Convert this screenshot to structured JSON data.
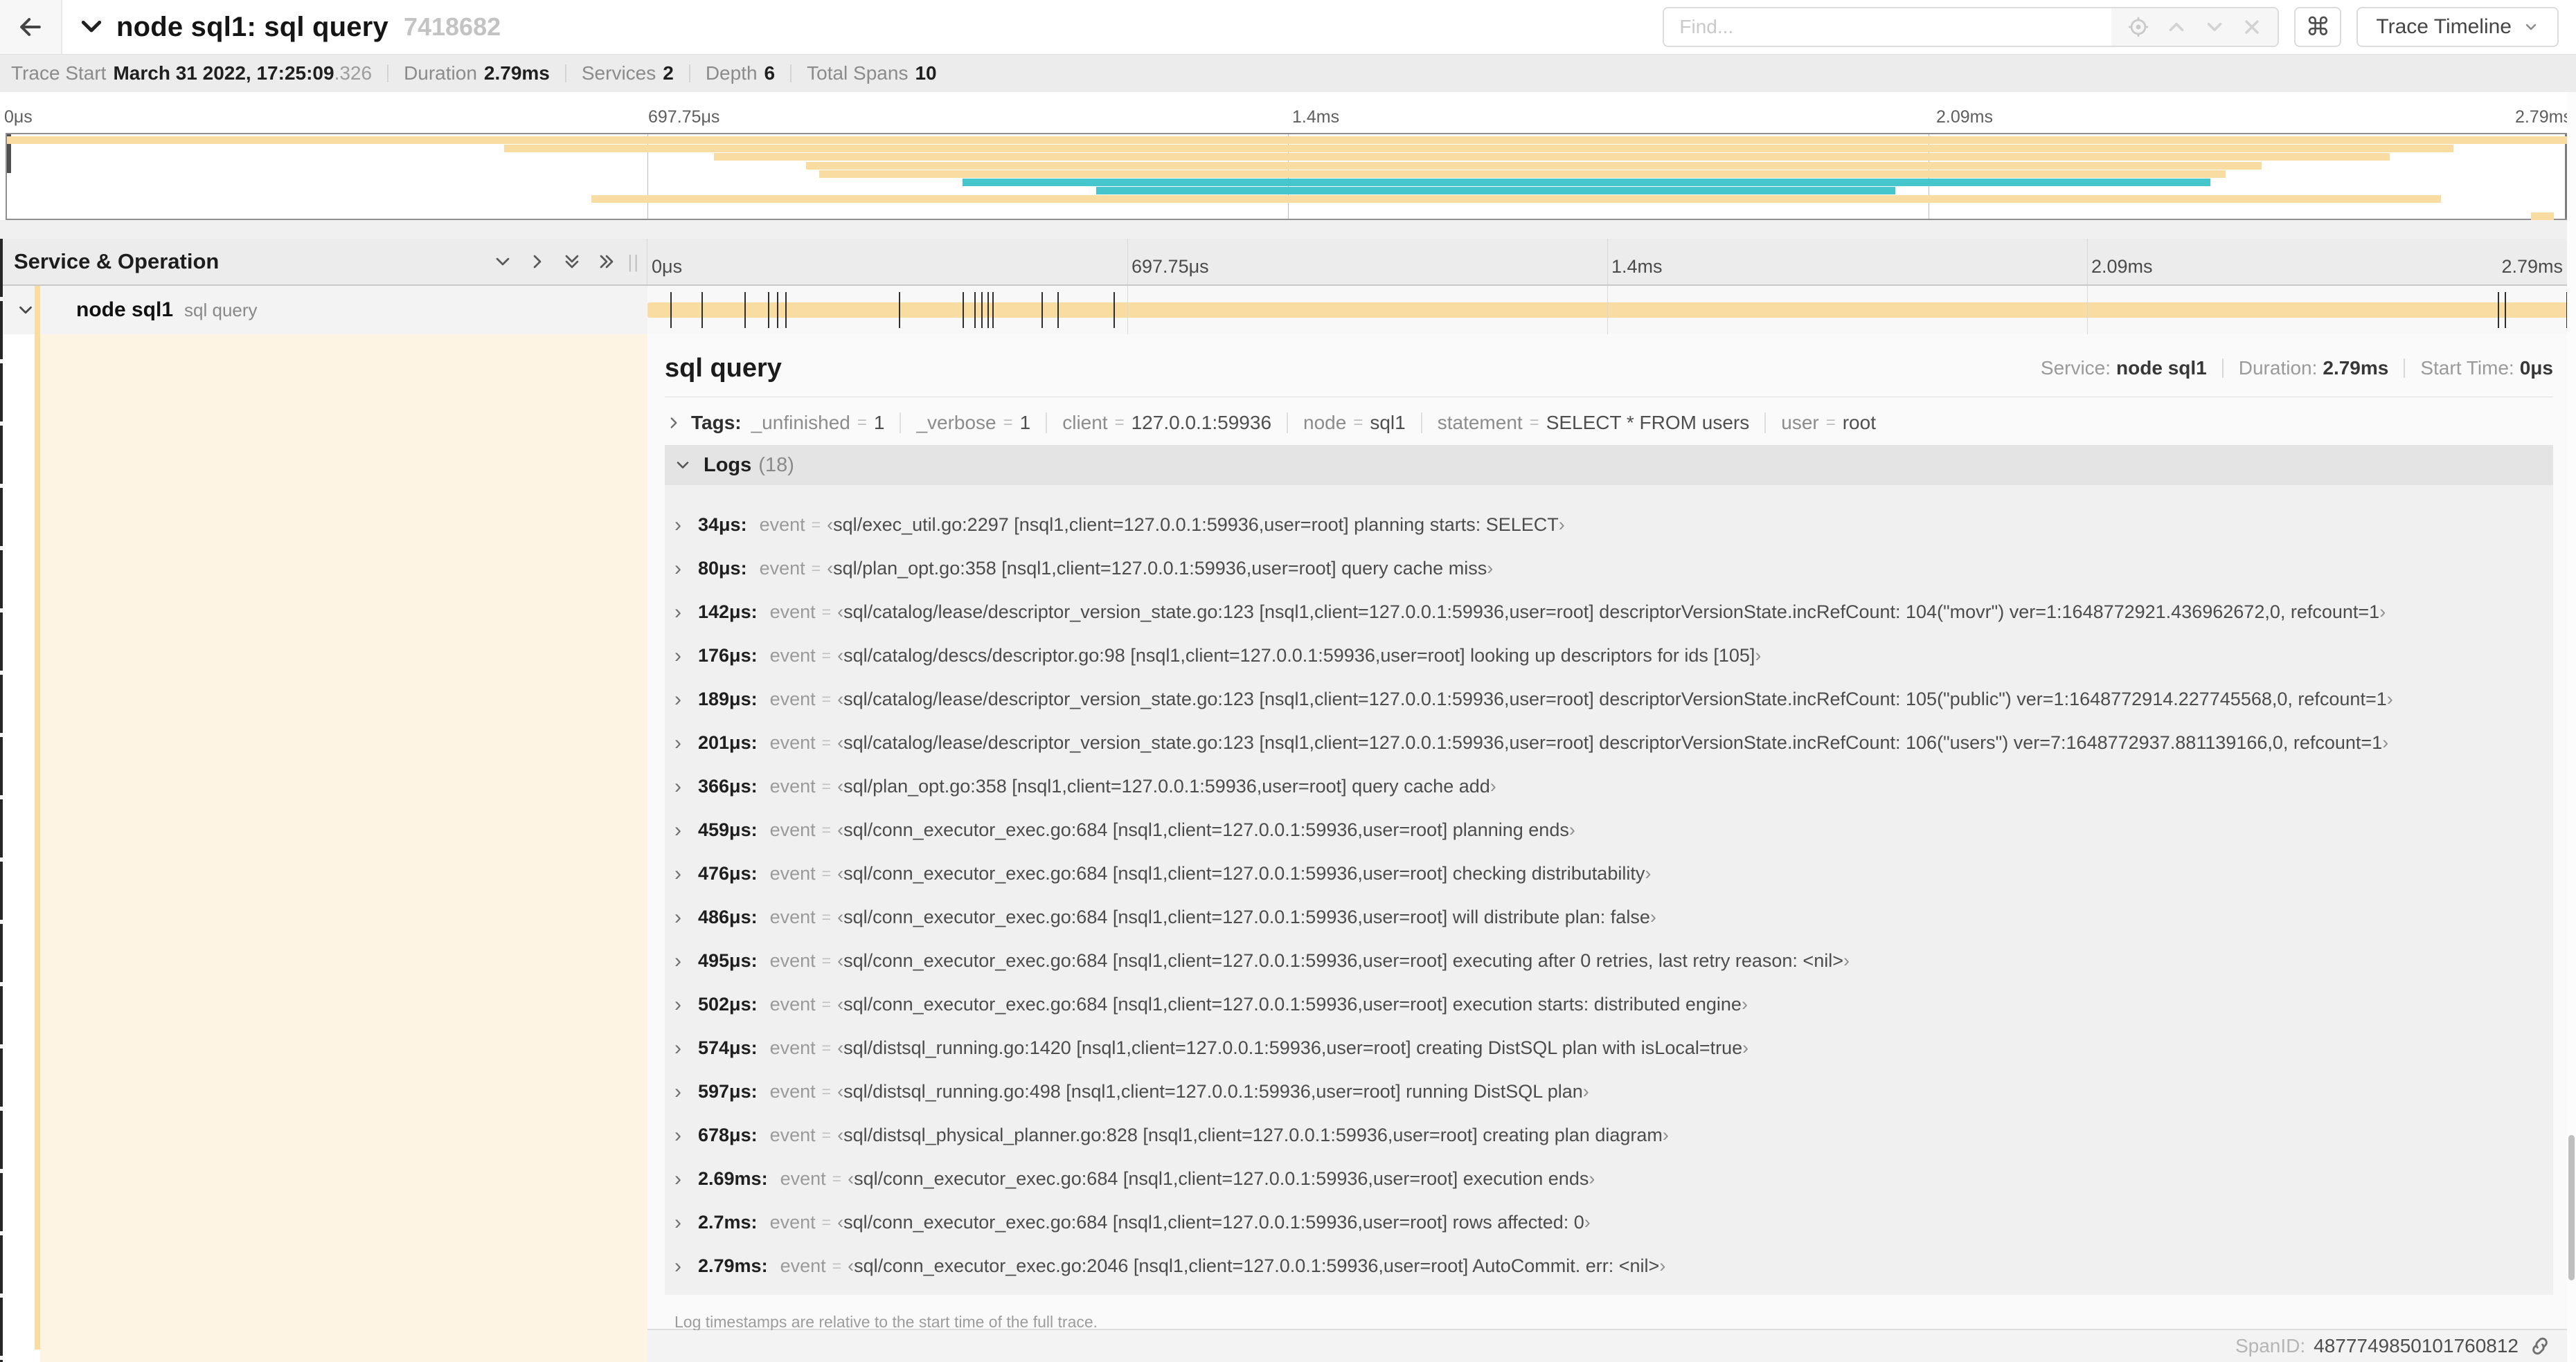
{
  "colors": {
    "tan": "#F8DCA1",
    "teal": "#45C6CC",
    "detail_tint": "#FDF4E3"
  },
  "glyphs": {
    "eq": "=",
    "open_angle": "‹",
    "close_angle": "›",
    "back_arrow": "←",
    "command": "⌘",
    "grip": "||"
  },
  "header": {
    "title": "node sql1: sql query",
    "trace_id": "7418682",
    "find_placeholder": "Find...",
    "view_selector_label": "Trace Timeline"
  },
  "trace_info": {
    "items": [
      {
        "label": "Trace Start",
        "value": "March 31 2022, 17:25:09",
        "suffix": ".326"
      },
      {
        "label": "Duration",
        "value": "2.79ms"
      },
      {
        "label": "Services",
        "value": "2"
      },
      {
        "label": "Depth",
        "value": "6"
      },
      {
        "label": "Total Spans",
        "value": "10"
      }
    ]
  },
  "timeline_ticks": [
    {
      "label": "0μs",
      "pos": 0
    },
    {
      "label": "697.75μs",
      "pos": 0.25
    },
    {
      "label": "1.4ms",
      "pos": 0.5
    },
    {
      "label": "2.09ms",
      "pos": 0.75
    },
    {
      "label": "2.79ms",
      "pos": 1
    }
  ],
  "minimap": {
    "bars": [
      {
        "row": 0,
        "start": 0.0,
        "end": 1.0,
        "color": "tan"
      },
      {
        "row": 1,
        "start": 0.194,
        "end": 0.955,
        "color": "tan"
      },
      {
        "row": 2,
        "start": 0.276,
        "end": 0.93,
        "color": "tan"
      },
      {
        "row": 3,
        "start": 0.312,
        "end": 0.88,
        "color": "tan"
      },
      {
        "row": 4,
        "start": 0.317,
        "end": 0.866,
        "color": "tan"
      },
      {
        "row": 5,
        "start": 0.373,
        "end": 0.86,
        "color": "teal"
      },
      {
        "row": 6,
        "start": 0.425,
        "end": 0.737,
        "color": "teal"
      },
      {
        "row": 7,
        "start": 0.228,
        "end": 0.95,
        "color": "tan"
      },
      {
        "row": 9,
        "start": 0.985,
        "end": 0.994,
        "color": "tan"
      }
    ]
  },
  "span_tree": {
    "header_title": "Service & Operation",
    "row": {
      "service": "node sql1",
      "operation": "sql query"
    }
  },
  "span_row": {
    "duration_us": 2790,
    "marks_us": [
      34,
      80,
      142,
      176,
      189,
      201,
      366,
      459,
      476,
      486,
      495,
      502,
      574,
      597,
      678,
      2690,
      2700,
      2790
    ]
  },
  "detail": {
    "title": "sql query",
    "overview": [
      {
        "label": "Service:",
        "value": "node sql1"
      },
      {
        "label": "Duration:",
        "value": "2.79ms"
      },
      {
        "label": "Start Time:",
        "value": "0μs"
      }
    ],
    "tags": {
      "label": "Tags:",
      "items": [
        {
          "key": "_unfinished",
          "value": "1"
        },
        {
          "key": "_verbose",
          "value": "1"
        },
        {
          "key": "client",
          "value": "127.0.0.1:59936"
        },
        {
          "key": "node",
          "value": "sql1"
        },
        {
          "key": "statement",
          "value": "SELECT * FROM users"
        },
        {
          "key": "user",
          "value": "root"
        }
      ]
    },
    "logs": {
      "label": "Logs",
      "count": "(18)",
      "note": "Log timestamps are relative to the start time of the full trace.",
      "entries": [
        {
          "t": "34μs:",
          "key": "event",
          "value": "sql/exec_util.go:2297 [nsql1,client=127.0.0.1:59936,user=root] planning starts: SELECT"
        },
        {
          "t": "80μs:",
          "key": "event",
          "value": "sql/plan_opt.go:358 [nsql1,client=127.0.0.1:59936,user=root] query cache miss"
        },
        {
          "t": "142μs:",
          "key": "event",
          "value": "sql/catalog/lease/descriptor_version_state.go:123 [nsql1,client=127.0.0.1:59936,user=root] descriptorVersionState.incRefCount: 104(\"movr\") ver=1:1648772921.436962672,0, refcount=1"
        },
        {
          "t": "176μs:",
          "key": "event",
          "value": "sql/catalog/descs/descriptor.go:98 [nsql1,client=127.0.0.1:59936,user=root] looking up descriptors for ids [105]"
        },
        {
          "t": "189μs:",
          "key": "event",
          "value": "sql/catalog/lease/descriptor_version_state.go:123 [nsql1,client=127.0.0.1:59936,user=root] descriptorVersionState.incRefCount: 105(\"public\") ver=1:1648772914.227745568,0, refcount=1"
        },
        {
          "t": "201μs:",
          "key": "event",
          "value": "sql/catalog/lease/descriptor_version_state.go:123 [nsql1,client=127.0.0.1:59936,user=root] descriptorVersionState.incRefCount: 106(\"users\") ver=7:1648772937.881139166,0, refcount=1"
        },
        {
          "t": "366μs:",
          "key": "event",
          "value": "sql/plan_opt.go:358 [nsql1,client=127.0.0.1:59936,user=root] query cache add"
        },
        {
          "t": "459μs:",
          "key": "event",
          "value": "sql/conn_executor_exec.go:684 [nsql1,client=127.0.0.1:59936,user=root] planning ends"
        },
        {
          "t": "476μs:",
          "key": "event",
          "value": "sql/conn_executor_exec.go:684 [nsql1,client=127.0.0.1:59936,user=root] checking distributability"
        },
        {
          "t": "486μs:",
          "key": "event",
          "value": "sql/conn_executor_exec.go:684 [nsql1,client=127.0.0.1:59936,user=root] will distribute plan: false"
        },
        {
          "t": "495μs:",
          "key": "event",
          "value": "sql/conn_executor_exec.go:684 [nsql1,client=127.0.0.1:59936,user=root] executing after 0 retries, last retry reason: <nil>"
        },
        {
          "t": "502μs:",
          "key": "event",
          "value": "sql/conn_executor_exec.go:684 [nsql1,client=127.0.0.1:59936,user=root] execution starts: distributed engine"
        },
        {
          "t": "574μs:",
          "key": "event",
          "value": "sql/distsql_running.go:1420 [nsql1,client=127.0.0.1:59936,user=root] creating DistSQL plan with isLocal=true"
        },
        {
          "t": "597μs:",
          "key": "event",
          "value": "sql/distsql_running.go:498 [nsql1,client=127.0.0.1:59936,user=root] running DistSQL plan"
        },
        {
          "t": "678μs:",
          "key": "event",
          "value": "sql/distsql_physical_planner.go:828 [nsql1,client=127.0.0.1:59936,user=root] creating plan diagram"
        },
        {
          "t": "2.69ms:",
          "key": "event",
          "value": "sql/conn_executor_exec.go:684 [nsql1,client=127.0.0.1:59936,user=root] execution ends"
        },
        {
          "t": "2.7ms:",
          "key": "event",
          "value": "sql/conn_executor_exec.go:684 [nsql1,client=127.0.0.1:59936,user=root] rows affected: 0"
        },
        {
          "t": "2.79ms:",
          "key": "event",
          "value": "sql/conn_executor_exec.go:2046 [nsql1,client=127.0.0.1:59936,user=root] AutoCommit. err: <nil>"
        }
      ]
    },
    "span_id_label": "SpanID:",
    "span_id": "4877749850101760812"
  }
}
